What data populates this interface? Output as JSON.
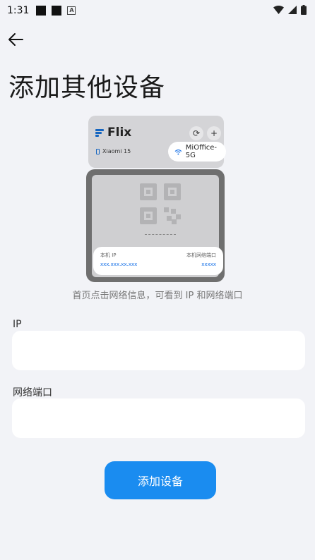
{
  "status_bar": {
    "time": "1:31"
  },
  "header": {
    "title": "添加其他设备"
  },
  "illustration": {
    "app_name": "Flix",
    "device": "Xiaomi 15",
    "wifi": "MiOffice-5G",
    "ip_label": "本机 IP",
    "ip_value": "xxx.xxx.xx.xxx",
    "port_label": "本机网络端口",
    "port_value": "xxxxx"
  },
  "hint": "首页点击网络信息，可看到 IP 和网络端口",
  "form": {
    "ip_label": "IP",
    "ip_value": "",
    "port_label": "网络端口",
    "port_value": ""
  },
  "submit_label": "添加设备",
  "colors": {
    "accent": "#1a8cf0",
    "background": "#f2f3f7"
  }
}
